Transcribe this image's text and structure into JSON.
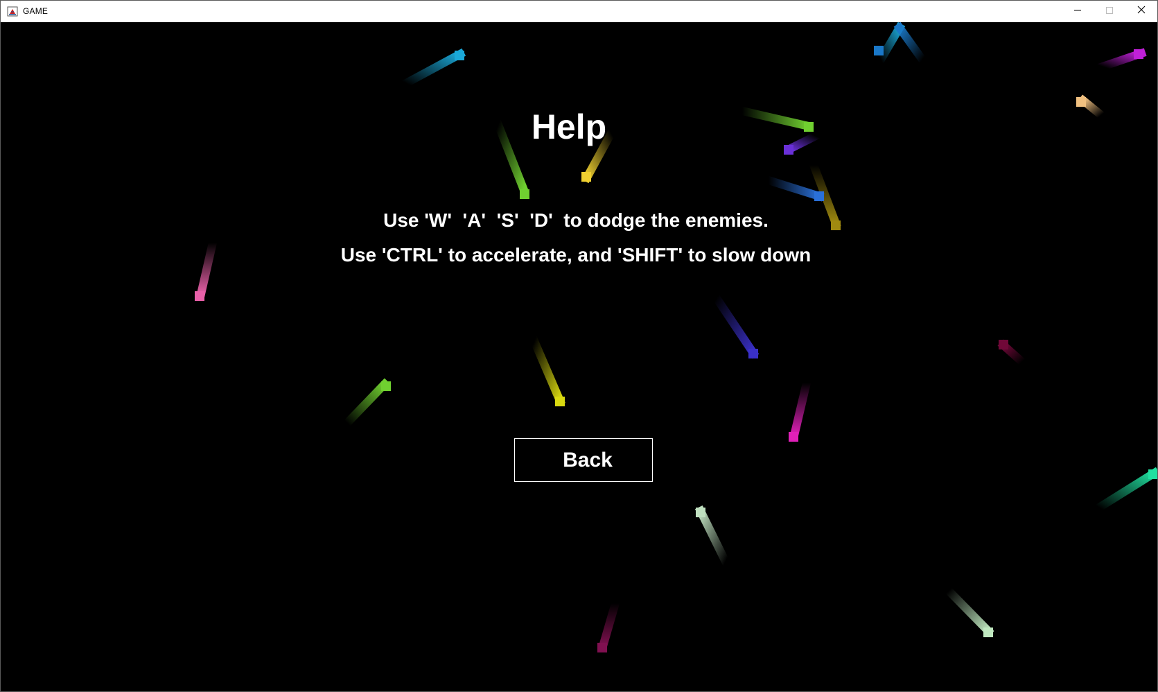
{
  "window": {
    "title": "GAME"
  },
  "icons": {
    "app": "java-cup-icon",
    "minimize": "minimize-icon",
    "maximize": "maximize-icon",
    "close": "close-icon"
  },
  "help": {
    "title": "Help",
    "line1": "Use 'W'  'A'  'S'  'D'  to dodge the enemies.",
    "line2": "Use 'CTRL' to accelerate, and 'SHIFT' to slow down",
    "back_label": "Back"
  },
  "colors": {
    "background": "#000000",
    "text": "#ffffff",
    "particles": [
      "#1aa8d8",
      "#1a78c8",
      "#c020d8",
      "#f0c080",
      "#70d030",
      "#f0d030",
      "#6a30d8",
      "#2a70d8",
      "#a08a10",
      "#e860a8",
      "#3a30c8",
      "#700838",
      "#70d030",
      "#d8d810",
      "#e020b8",
      "#20e0a0",
      "#c0e0c0",
      "#c0e8c0",
      "#801050"
    ]
  }
}
